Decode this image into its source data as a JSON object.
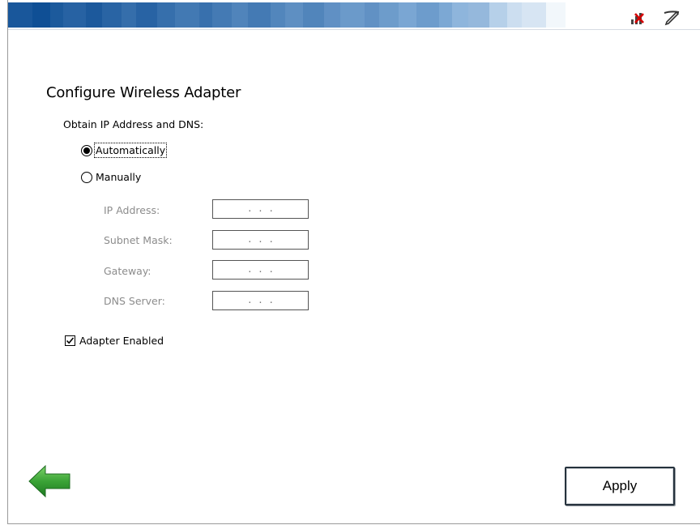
{
  "header": {
    "network_icon": "network-disconnected-icon",
    "pen_icon": "stylus-icon"
  },
  "title": "Configure Wireless Adapter",
  "ip_section": {
    "label": "Obtain IP Address and DNS:",
    "options": [
      {
        "label": "Automatically",
        "selected": true
      },
      {
        "label": "Manually",
        "selected": false
      }
    ]
  },
  "fields": [
    {
      "label": "IP Address:",
      "value": ". . ."
    },
    {
      "label": "Subnet Mask:",
      "value": ". . ."
    },
    {
      "label": "Gateway:",
      "value": ". . ."
    },
    {
      "label": "DNS Server:",
      "value": ". . ."
    }
  ],
  "adapter_enabled": {
    "label": "Adapter Enabled",
    "checked": true
  },
  "footer": {
    "back_icon": "back-arrow-icon",
    "apply_label": "Apply"
  },
  "colors": {
    "header_blue_dark": "#0f4f95",
    "header_blue_light": "#8fb7df",
    "back_arrow_green": "#3aa336",
    "disabled_text": "#8c8c8c"
  }
}
